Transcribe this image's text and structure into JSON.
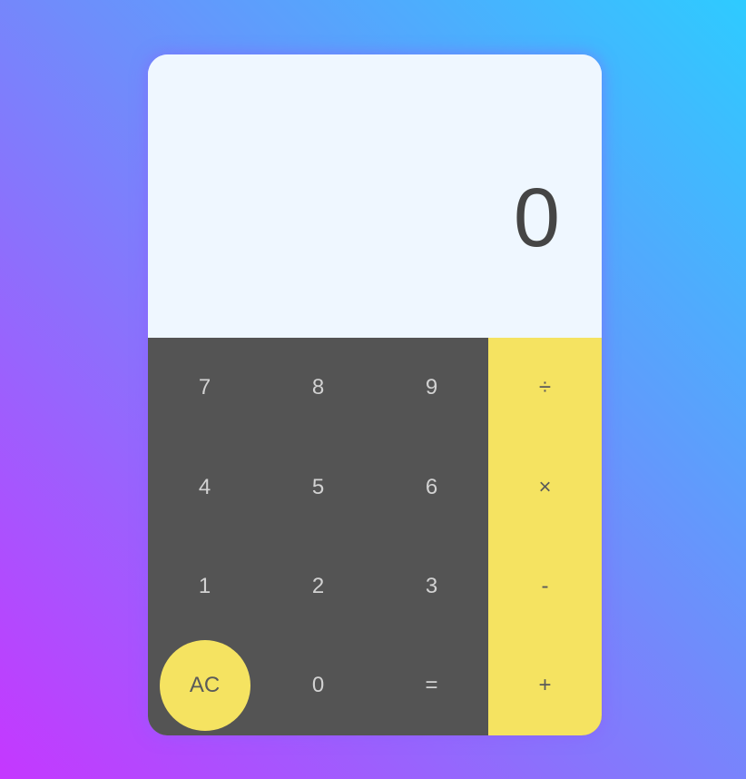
{
  "display": {
    "value": "0"
  },
  "keys": {
    "k7": "7",
    "k8": "8",
    "k9": "9",
    "divide": "÷",
    "k4": "4",
    "k5": "5",
    "k6": "6",
    "multiply": "×",
    "k1": "1",
    "k2": "2",
    "k3": "3",
    "subtract": "-",
    "clear": "AC",
    "k0": "0",
    "equals": "=",
    "add": "+"
  },
  "colors": {
    "display_bg": "#eff7ff",
    "display_text": "#454545",
    "keypad_bg": "#545454",
    "operator_bg": "#f5e361",
    "gradient_start": "#2ecbff",
    "gradient_end": "#c537ff"
  }
}
